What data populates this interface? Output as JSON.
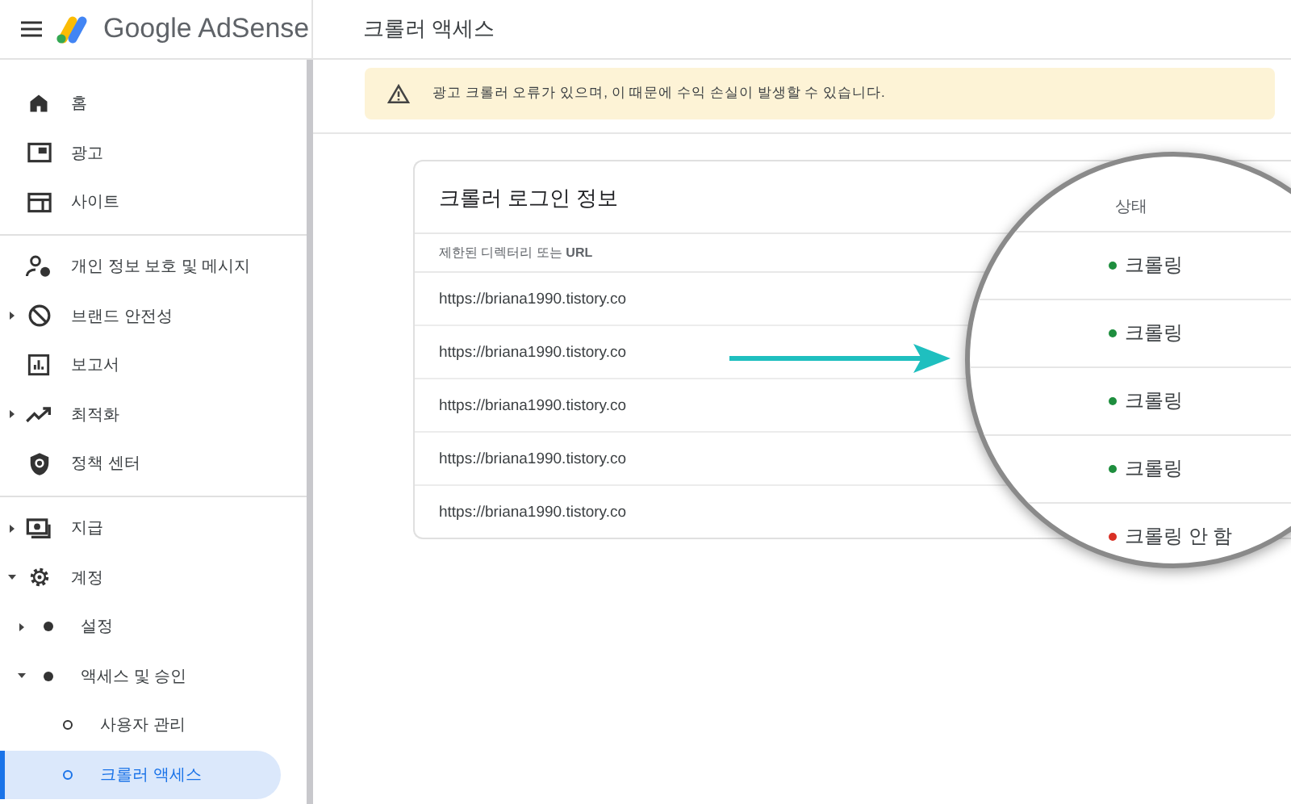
{
  "header": {
    "product": "Google AdSense",
    "page_title": "크롤러 액세스"
  },
  "sidebar": {
    "sections": [
      {
        "items": [
          {
            "label": "홈",
            "selected": false
          },
          {
            "label": "광고",
            "selected": false
          },
          {
            "label": "사이트",
            "selected": false
          }
        ]
      },
      {
        "items": [
          {
            "label": "개인 정보 보호 및 메시지",
            "selected": false
          },
          {
            "label": "브랜드 안전성",
            "selected": false,
            "expanded": false
          },
          {
            "label": "보고서",
            "selected": false
          },
          {
            "label": "최적화",
            "selected": false,
            "expanded": false
          },
          {
            "label": "정책 센터",
            "selected": false
          }
        ]
      },
      {
        "items": [
          {
            "label": "지급",
            "selected": false,
            "expanded": false
          },
          {
            "label": "계정",
            "selected": false,
            "expanded": true,
            "children": [
              {
                "label": "설정",
                "selected": false,
                "expanded": false
              },
              {
                "label": "액세스 및 승인",
                "selected": false,
                "expanded": true,
                "children": [
                  {
                    "label": "사용자 관리",
                    "selected": false
                  },
                  {
                    "label": "크롤러 액세스",
                    "selected": true
                  }
                ]
              }
            ]
          }
        ]
      }
    ]
  },
  "alert": {
    "message": "광고 크롤러 오류가 있으며, 이 때문에 수익 손실이 발생할 수 있습니다."
  },
  "card": {
    "title": "크롤러 로그인 정보",
    "table": {
      "columns": [
        "제한된 디렉터리 또는 **URL**",
        "상태"
      ],
      "rows": [
        {
          "url": "https://briana1990.tistory.co",
          "status": "크롤링",
          "color": "#1e8e3e"
        },
        {
          "url": "https://briana1990.tistory.co",
          "status": "크롤링",
          "color": "#1e8e3e"
        },
        {
          "url": "https://briana1990.tistory.co",
          "status": "크롤링",
          "color": "#1e8e3e"
        },
        {
          "url": "https://briana1990.tistory.co",
          "status": "크롤링",
          "color": "#1e8e3e"
        },
        {
          "url": "https://briana1990.tistory.co",
          "status": "크롤링 안 함",
          "color": "#d93025"
        }
      ]
    }
  }
}
